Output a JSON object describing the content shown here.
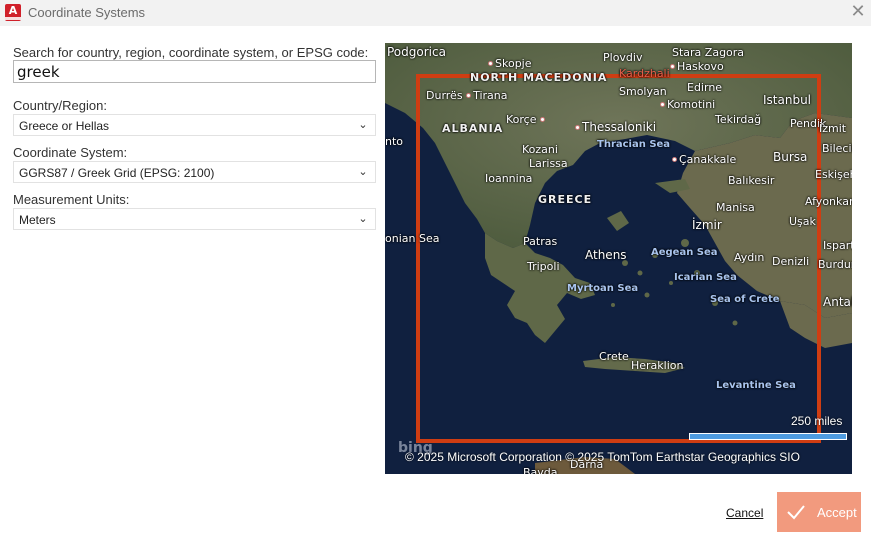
{
  "window": {
    "title": "Coordinate Systems",
    "app_icon_letter": "A"
  },
  "form": {
    "search_label": "Search for country, region, coordinate system, or EPSG code:",
    "search_value": "greek",
    "country_label": "Country/Region:",
    "country_value": "Greece or Hellas",
    "coord_label": "Coordinate System:",
    "coord_value": "GGRS87 / Greek Grid (EPSG: 2100)",
    "units_label": "Measurement Units:",
    "units_value": "Meters"
  },
  "map": {
    "selection_color": "#cf3d12",
    "places": {
      "podgorica": "Podgorica",
      "skopje": "Skopje",
      "plovdiv": "Plovdiv",
      "stara_zagora": "Stara Zagora",
      "north_macedonia": "NORTH MACEDONIA",
      "kardzhali": "Kardzhali",
      "haskovo": "Haskovo",
      "durres": "Durrës",
      "tirana": "Tirana",
      "smolyan": "Smolyan",
      "edirne": "Edirne",
      "komotini": "Komotini",
      "istanbul": "Istanbul",
      "albania": "ALBANIA",
      "korce": "Korçe",
      "thessaloniki": "Thessaloniki",
      "tekirdag": "Tekirdağ",
      "pendik": "Pendik",
      "izmit": "İzmit",
      "nto": "nto",
      "thracian_sea": "Thracian Sea",
      "kozani": "Kozani",
      "larissa": "Larissa",
      "canakkale": "Çanakkale",
      "bursa": "Bursa",
      "bilecik": "Bilecik",
      "ioannina": "Ioannina",
      "balikesir": "Balıkesir",
      "eskisehir": "Eskişeh",
      "greece": "GREECE",
      "afyonkara": "Afyonkara",
      "manisa": "Manisa",
      "usak": "Uşak",
      "izmir": "İzmir",
      "onian_sea": "onian Sea",
      "patras": "Patras",
      "athens": "Athens",
      "aegean_sea": "Aegean Sea",
      "aydin": "Aydın",
      "denizli": "Denizli",
      "ispart": "Ispart",
      "tripoli": "Tripoli",
      "burdur": "Burdur",
      "icarian_sea": "Icarian Sea",
      "myrtoan_sea": "Myrtoan Sea",
      "sea_of_crete": "Sea of Crete",
      "antal": "Antal",
      "crete": "Crete",
      "heraklion": "Heraklion",
      "levantine_sea": "Levantine Sea",
      "darna": "Darna",
      "bayda": "Bayda"
    },
    "scale_label": "250 miles",
    "bing_logo": "bing",
    "attribution": "© 2025 Microsoft Corporation   © 2025 TomTom   Earthstar Geographics  SIO"
  },
  "footer": {
    "cancel_label": "Cancel",
    "accept_label": "Accept"
  }
}
